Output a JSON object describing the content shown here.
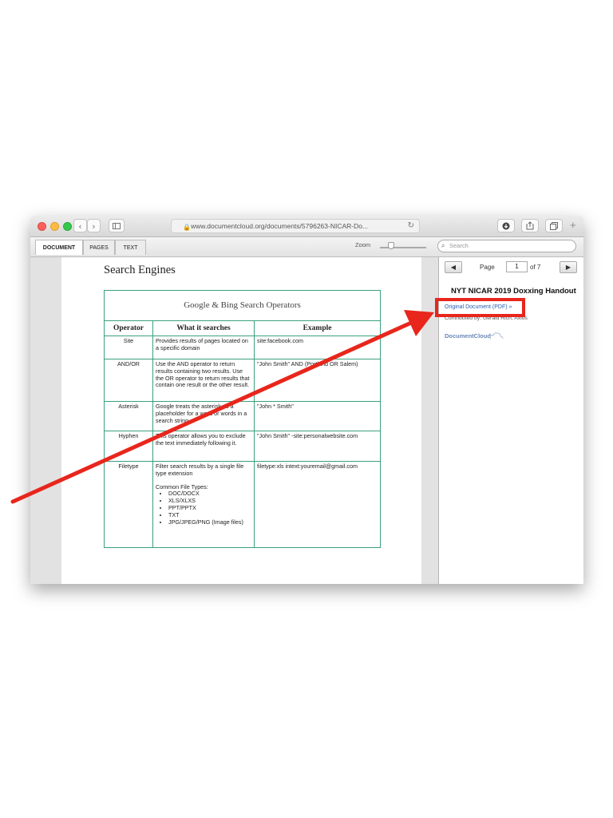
{
  "browser": {
    "url": "www.documentcloud.org/documents/5796263-NICAR-Do..."
  },
  "viewer": {
    "tabs": [
      {
        "label": "DOCUMENT",
        "active": true
      },
      {
        "label": "PAGES",
        "active": false
      },
      {
        "label": "TEXT",
        "active": false
      }
    ],
    "zoom_label": "Zoom",
    "search_placeholder": "Search"
  },
  "document": {
    "heading": "Search Engines",
    "table": {
      "caption": "Google & Bing Search Operators",
      "headers": [
        "Operator",
        "What it searches",
        "Example"
      ],
      "rows": [
        {
          "operator": "Site",
          "what": "Provides results of pages located on a specific domain",
          "example": "site:facebook.com"
        },
        {
          "operator": "AND/OR",
          "what": "Use the AND operator to return results containing two results. Use the OR operator to return results that contain one result or the other result.",
          "example": "\"John Smith\" AND (Portland OR Salem)"
        },
        {
          "operator": "Asterisk",
          "what": "Google treats the asterisk as a placeholder for a word or words in a search string.",
          "example": "\"John * Smith\""
        },
        {
          "operator": "Hyphen",
          "what": "This operator allows you to exclude the text immediately following it.",
          "example": "\"John Smith\" -site:personalwebsite.com"
        },
        {
          "operator": "Filetype",
          "what": "Filter search results by a single file type extension",
          "what_subheading": "Common File Types:",
          "what_list": [
            "DOC/DOCX",
            "XLS/XLXS",
            "PPT/PPTX",
            "TXT",
            "JPG/JPEG/PNG (Image files)"
          ],
          "example": "filetype:xls intext:youremail@gmail.com"
        }
      ]
    }
  },
  "sidebar": {
    "page_label": "Page",
    "page_number": "1",
    "page_of": "of 7",
    "prev_icon": "triangle-left",
    "next_icon": "triangle-right",
    "doc_title": "NYT NICAR 2019 Doxxing Handout",
    "original_link": "Original Document (PDF) »",
    "contributed": "Contributed by: Gerald Rich, Axios",
    "logo_text": "DocumentCloud"
  },
  "annotation": {
    "color": "#e8261c"
  }
}
